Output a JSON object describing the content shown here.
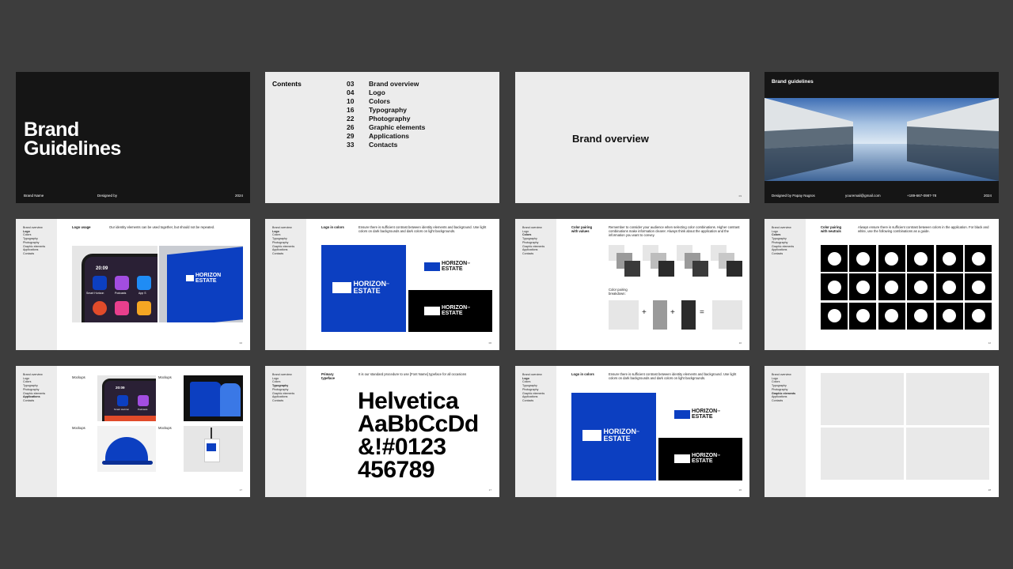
{
  "colors": {
    "background": "#3d3d3d",
    "brand_blue": "#0c3fc1",
    "dark": "#151515",
    "light": "#ececec"
  },
  "nav": [
    "Brand overview",
    "Logo",
    "Colors",
    "Typography",
    "Photography",
    "Graphic elements",
    "Applications",
    "Contacts"
  ],
  "cover": {
    "title_line1": "Brand",
    "title_line2": "Guidelines",
    "brand_name": "Brand Name",
    "designed_by": "Designed by",
    "year": "2024"
  },
  "contents": {
    "heading": "Contents",
    "items": [
      {
        "page": "03",
        "label": "Brand overview"
      },
      {
        "page": "04",
        "label": "Logo"
      },
      {
        "page": "10",
        "label": "Colors"
      },
      {
        "page": "16",
        "label": "Typography"
      },
      {
        "page": "22",
        "label": "Photography"
      },
      {
        "page": "26",
        "label": "Graphic elements"
      },
      {
        "page": "29",
        "label": "Applications"
      },
      {
        "page": "33",
        "label": "Contacts"
      }
    ]
  },
  "overview": {
    "title": "Brand overview"
  },
  "photo_slide": {
    "title": "Brand guidelines",
    "designer": "Designed by Papay Nugros",
    "email": "youremail@gmail.com",
    "phone": "+189-667-0987-78",
    "year": "2024"
  },
  "logo_usage": {
    "heading": "Logo usage",
    "text": "Our identity elements can be used together, but should not be repeated.",
    "app1": "Smart Horizon",
    "app2": "Podcasts",
    "app3": "App S",
    "time": "20:09"
  },
  "logo_colors": {
    "heading": "Logo in colors",
    "text": "Ensure there is sufficient contrast between identity elements and background. Use light colors on dark backgrounds and dark colors on light backgrounds."
  },
  "brand_logo": {
    "line1": "HORIZON",
    "line2": "ESTATE",
    "tm": "™"
  },
  "pairing_values": {
    "heading_line1": "Color pairing",
    "heading_line2": "with values",
    "text": "Remember to consider your audience when selecting color combinations. Higher contrast combinations make information clearer. Always think about the application and the information you want to convey.",
    "breakdown_line1": "Color pairing",
    "breakdown_line2": "breakdown:",
    "plus": "+",
    "equals": "="
  },
  "pairing_neutrals": {
    "heading_line1": "Color pairing",
    "heading_line2": "with neutrals",
    "text": "Always ensure there is sufficient contrast between colors in the application. For black and white, use the following combinations as a guide."
  },
  "mockups": {
    "label": "Mockups",
    "time": "20:09",
    "app1": "Smart Horizon",
    "app2": "Podcasts"
  },
  "typeface": {
    "heading_line1": "Primary",
    "heading_line2": "typeface",
    "text": "It is our standard procedure to use [Font Name] typeface for all occasions",
    "line1": "Helvetica",
    "line2": "AaBbCcDd",
    "line3": "&!#0123",
    "line4": "456789"
  },
  "page_numbers": {
    "p5": "02",
    "p6": "06",
    "p7": "10",
    "p8": "12",
    "p9": "17",
    "p10": "17",
    "p11": "26",
    "p12": "28",
    "p4": "03"
  }
}
